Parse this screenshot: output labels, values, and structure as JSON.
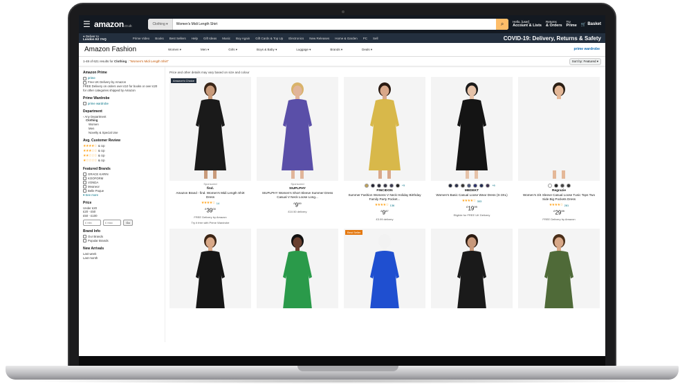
{
  "header": {
    "logo": "amazon",
    "logo_suffix": ".co.uk",
    "search_category": "Clothing",
    "search_value": "Women's Midi Length Shirt",
    "account_line1": "Hello, [user]",
    "account_line2": "Account & Lists",
    "returns_line1": "Returns",
    "returns_line2": "& Orders",
    "prime_line1": "Try",
    "prime_line2": "Prime",
    "basket": "Basket",
    "deliver_line1": "Deliver to",
    "deliver_line2": "London E2 7AQ"
  },
  "subnav": {
    "links": [
      "Prime Video",
      "Books",
      "Best Sellers",
      "Help",
      "Gift Ideas",
      "Music",
      "Buy Again",
      "Gift Cards & Top Up",
      "Electronics",
      "New Releases",
      "Home & Garden",
      "PC",
      "Sell"
    ],
    "banner": "COVID-19: Delivery, Returns & Safety"
  },
  "fashion": {
    "title": "Amazon Fashion",
    "categories": [
      "Women",
      "Men",
      "Girls",
      "Boys & Baby",
      "Luggage",
      "Brands",
      "Deals"
    ],
    "prime_line1": "prime",
    "prime_line2": "wardrobe"
  },
  "results": {
    "prefix": "1-48 of 621 results for",
    "category": "Clothing",
    "query": "\"Women's Midi Length Shirt\"",
    "sort_label": "Sort by: Featured"
  },
  "sidebar": {
    "prime_heading": "Amazon Prime",
    "prime_option": "prime",
    "free_uk": "Free UK Delivery by Amazon",
    "free_note": "FREE Delivery on orders over £10 for books or over £20 for other categories shipped by Amazon",
    "wardrobe_heading": "Prime Wardrobe",
    "wardrobe_option": "prime wardrobe",
    "department_heading": "Department",
    "dept_any": "‹ Any Department",
    "dept_items": [
      "Clothing",
      "Women",
      "Men",
      "Novelty & Special Use"
    ],
    "review_heading": "Avg. Customer Review",
    "review_items": [
      "★★★★☆",
      "★★★☆☆",
      "★★☆☆☆",
      "★☆☆☆☆"
    ],
    "review_suffix": "& Up",
    "brands_heading": "Featured Brands",
    "brands": [
      "GRACE KARIN",
      "KOOFORM",
      "VONDA",
      "Meaneor",
      "Belle Poque"
    ],
    "see_more": "See more",
    "price_heading": "Price",
    "prices": [
      "Under £20",
      "£20 - £50",
      "£50 - £100"
    ],
    "price_min": "£ Min",
    "price_max": "£ Max",
    "go": "Go",
    "brand_info_heading": "Brand Info",
    "brand_info": [
      "Our Brands",
      "Popular Brands"
    ],
    "new_arrivals_heading": "New Arrivals",
    "new_arrivals": [
      "Last week",
      "Last month"
    ]
  },
  "content": {
    "note": "Price and other details may vary based on size and colour",
    "products": [
      {
        "badge": "Amazon's Choice",
        "sponsored": "Sponsored",
        "brand": "find.",
        "title": "Amazon Brand - find. Women's Midi Length Shirt Dress",
        "rating": 4,
        "reviews": "14",
        "price_main": "39",
        "price_frac": "00",
        "delivery": "FREE Delivery by Amazon",
        "extra": "Try it free with Prime Wardrobe",
        "dress": "#1a1a1a",
        "skin": "#c89a7a",
        "hair": "#3a2618",
        "swatches": []
      },
      {
        "badge": "",
        "sponsored": "Sponsored",
        "brand": "SIUPLPHY",
        "title": "SIUPLPHY Women's Short Sleeve Summer Dress Casual V Neck Loose Long...",
        "rating": 0,
        "reviews": "",
        "price_main": "9",
        "price_frac": "99",
        "delivery": "£10.50 delivery",
        "extra": "",
        "dress": "#5a4fa8",
        "skin": "#e1b59a",
        "hair": "#d9b36a",
        "swatches": []
      },
      {
        "badge": "",
        "sponsored": "",
        "brand": "FINCIDON",
        "title": "Summer Fashion Womens V Neck Holiday Birthday Family Party Pocket...",
        "rating": 4,
        "reviews": "136",
        "price_main": "9",
        "price_frac": "87",
        "delivery": "£3.99 delivery",
        "extra": "",
        "dress": "#d8b84a",
        "skin": "#d9a88a",
        "hair": "#2a1a12",
        "swatches": [
          "#bfa25a",
          "#222233",
          "#2a2a3a",
          "#333344",
          "#3a3a52",
          "#222"
        ],
        "more": "+5"
      },
      {
        "badge": "",
        "sponsored": "",
        "brand": "MEDEKT",
        "title": "Women's Basic Casual Loose Wear Dress (S-3XL)",
        "rating": 4,
        "reviews": "303",
        "price_main": "19",
        "price_frac": "99",
        "delivery": "Eligible for FREE UK Delivery",
        "extra": "",
        "dress": "#141414",
        "skin": "#e6c2a8",
        "hair": "#1a1a1a",
        "swatches": [
          "#1d2338",
          "#2b2f4a",
          "#333",
          "#49557a",
          "#2a2f6a",
          "#1f2a52",
          "#3b2e4e"
        ],
        "more": "+6"
      },
      {
        "badge": "",
        "sponsored": "",
        "brand": "Regrazie",
        "title": "Women's 3/4 Sleeve Casual Loose Tunic Tops Two Side Big Pockets Dress",
        "rating": 4,
        "reviews": "281",
        "price_main": "29",
        "price_frac": "99",
        "delivery": "FREE Delivery by Amazon",
        "extra": "",
        "dress": "#f4f4f4",
        "skin": "#e4b898",
        "hair": "#2a1e14",
        "swatches": [
          "#ffffff",
          "#222",
          "#444",
          "#333"
        ],
        "more": ""
      },
      {
        "badge": "",
        "sponsored": "",
        "brand": "",
        "title": "",
        "rating": 0,
        "reviews": "",
        "price_main": "",
        "price_frac": "",
        "delivery": "",
        "extra": "",
        "dress": "#161616",
        "skin": "#d8a888",
        "hair": "#3b2414",
        "swatches": []
      },
      {
        "badge": "",
        "sponsored": "",
        "brand": "",
        "title": "",
        "rating": 0,
        "reviews": "",
        "price_main": "",
        "price_frac": "",
        "delivery": "",
        "extra": "",
        "dress": "#2a9a4a",
        "skin": "#6a4030",
        "hair": "#111",
        "swatches": []
      },
      {
        "badge": "Best Seller",
        "sponsored": "",
        "brand": "",
        "title": "",
        "rating": 0,
        "reviews": "",
        "price_main": "",
        "price_frac": "",
        "delivery": "",
        "extra": "",
        "dress": "#1f4fd0",
        "skin": "#f2f2f2",
        "hair": "#f2f2f2",
        "swatches": []
      },
      {
        "badge": "",
        "sponsored": "",
        "brand": "",
        "title": "",
        "rating": 0,
        "reviews": "",
        "price_main": "",
        "price_frac": "",
        "delivery": "",
        "extra": "",
        "dress": "#1a1a1a",
        "skin": "#c8987a",
        "hair": "#2a1a10",
        "swatches": []
      },
      {
        "badge": "",
        "sponsored": "",
        "brand": "",
        "title": "",
        "rating": 0,
        "reviews": "",
        "price_main": "",
        "price_frac": "",
        "delivery": "",
        "extra": "",
        "dress": "#4f6a38",
        "skin": "#d8a888",
        "hair": "#4a2e18",
        "swatches": []
      }
    ]
  },
  "colors": {
    "nav_dark": "#131921",
    "nav_sub": "#232f3e",
    "search_btn": "#febd69",
    "star": "#ffa41c",
    "link": "#007185",
    "query": "#c45500"
  }
}
